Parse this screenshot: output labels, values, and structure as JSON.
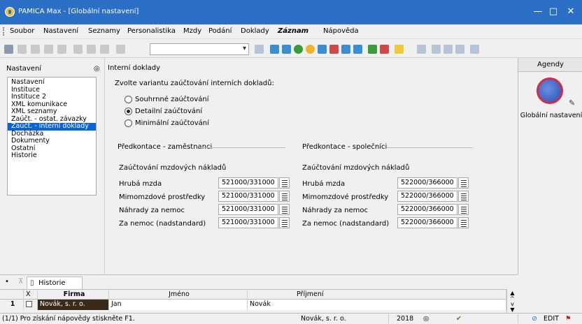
{
  "window": {
    "title": "PAMICA Max - [Globální nastavení]",
    "minimize": "—",
    "maximize": "□",
    "close": "✕"
  },
  "menu": [
    "Soubor",
    "Nastavení",
    "Seznamy",
    "Personalistika",
    "Mzdy",
    "Podání",
    "Doklady",
    "Záznam",
    "Nápověda"
  ],
  "left_panel": {
    "header": "Nastavení",
    "pin": "◎",
    "items": [
      "Nastavení",
      "Instituce",
      "Instituce 2",
      "XML komunikace",
      "XML seznamy",
      "Zaúčt. - ostat. závazky",
      "Zaúčt. - interní doklady",
      "Docházka",
      "Dokumenty",
      "Ostatní",
      "Historie"
    ],
    "selected_index": 6
  },
  "content": {
    "section_title": "Interní doklady",
    "question": "Zvolte variantu zaúčtování interních dokladů:",
    "radios": [
      {
        "label": "Souhrnné zaúčtování",
        "checked": false
      },
      {
        "label": "Detailní zaúčtování",
        "checked": true
      },
      {
        "label": "Minimální zaúčtování",
        "checked": false
      }
    ],
    "employees": {
      "title": "Předkontace - zaměstnanci",
      "subtitle": "Zaúčtování mzdových nákladů",
      "rows": [
        {
          "label": "Hrubá mzda",
          "value": "521000/331000"
        },
        {
          "label": "Mimomzdové prostředky",
          "value": "521000/331000"
        },
        {
          "label": "Náhrady za nemoc",
          "value": "521000/331000"
        },
        {
          "label": "Za nemoc (nadstandard)",
          "value": "521000/331000"
        }
      ]
    },
    "partners": {
      "title": "Předkontace - společníci",
      "subtitle": "Zaúčtování mzdových nákladů",
      "rows": [
        {
          "label": "Hrubá mzda",
          "value": "522000/366000"
        },
        {
          "label": "Mimomzdové prostředky",
          "value": "522000/366000"
        },
        {
          "label": "Náhrady za nemoc",
          "value": "522000/366000"
        },
        {
          "label": "Za nemoc (nadstandard)",
          "value": "522000/366000"
        }
      ]
    }
  },
  "right_panel": {
    "header": "Agendy",
    "item_label": "Globální nastavení"
  },
  "bottom": {
    "tab_label": "Historie",
    "columns": [
      "X",
      "Firma",
      "Jméno",
      "Příjmení"
    ],
    "row": {
      "num": "1",
      "firma": "Novák, s. r. o.",
      "jmeno": "Jan",
      "prijmeni": "Novák"
    }
  },
  "status": {
    "help": "(1/1) Pro získání nápovědy stiskněte F1.",
    "company": "Novák, s. r. o.",
    "year": "2018",
    "edit": "EDIT"
  },
  "colors": {
    "titlebar": "#2b6fc6",
    "selection": "#0a64d6",
    "firma_cell": "#3a2a1a"
  }
}
